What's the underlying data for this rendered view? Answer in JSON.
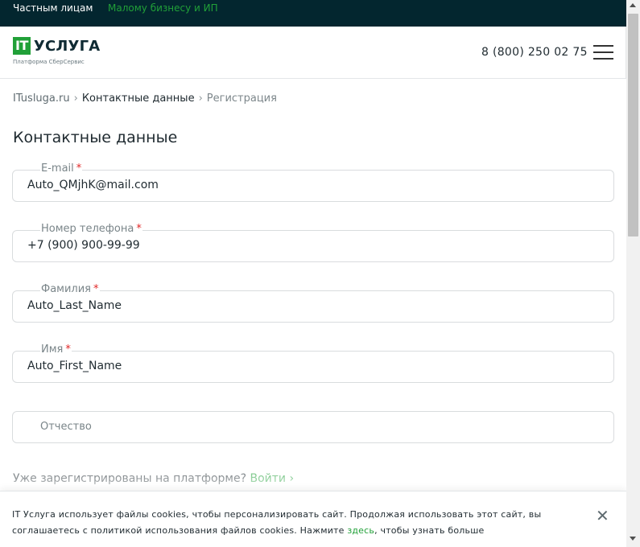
{
  "topbar": {
    "segment_private": "Частным лицам",
    "segment_business": "Малому бизнесу и ИП"
  },
  "header": {
    "logo_mark": "IT",
    "logo_word": "УСЛУГА",
    "logo_subtitle": "Платформа СберСервис",
    "phone": "8 (800) 250 02 75",
    "menu_icon": "hamburger-icon"
  },
  "breadcrumb": {
    "items": [
      "ITusluga.ru",
      "Контактные данные",
      "Регистрация"
    ],
    "separator": "›"
  },
  "page": {
    "title": "Контактные данные"
  },
  "form": {
    "fields": [
      {
        "label": "E-mail",
        "required_mark": "*",
        "value": "Auto_QMjhK@mail.com"
      },
      {
        "label": "Номер телефона",
        "required_mark": "*",
        "value": "+7 (900) 900-99-99"
      },
      {
        "label": "Фамилия",
        "required_mark": "*",
        "value": "Auto_Last_Name"
      },
      {
        "label": "Имя",
        "required_mark": "*",
        "value": "Auto_First_Name"
      },
      {
        "label": "",
        "required_mark": "",
        "value": "",
        "placeholder": "Отчество"
      }
    ],
    "already_text": "Уже зарегистрированы на платформе?",
    "login_label": "Войти ›"
  },
  "cookie": {
    "text_before": "IT Услуга использует файлы cookies, чтобы персонализировать сайт. Продолжая использовать этот сайт, вы соглашаетесь с политикой использования файлов cookies. Нажмите ",
    "link": "здесь",
    "text_after": ", чтобы узнать больше",
    "close": "✕"
  },
  "colors": {
    "accent": "#21a038",
    "topbar_bg": "#03262f",
    "required": "#e12626"
  }
}
